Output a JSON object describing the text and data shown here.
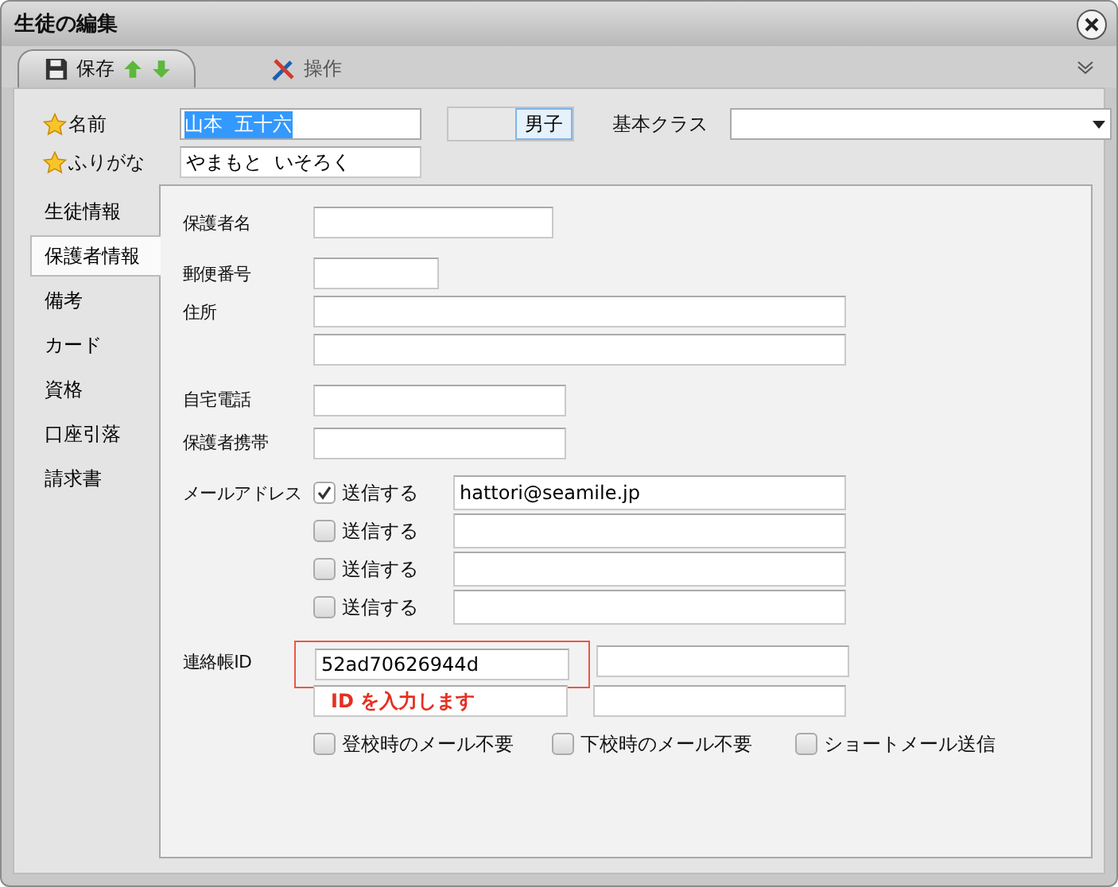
{
  "window": {
    "title": "生徒の編集"
  },
  "toolbar": {
    "tabs": [
      {
        "label": "保存",
        "selected": true
      },
      {
        "label": "操作",
        "selected": false
      }
    ]
  },
  "header": {
    "name": {
      "label": "名前",
      "value": "山本  五十六",
      "text_selected": true
    },
    "kana": {
      "label": "ふりがな",
      "value": "やまもと  いそろく"
    },
    "gender": {
      "label": "男子",
      "selected": true
    },
    "class": {
      "label": "基本クラス"
    }
  },
  "side_tabs": [
    {
      "label": "生徒情報",
      "selected": false
    },
    {
      "label": "保護者情報",
      "selected": true
    },
    {
      "label": "備考",
      "selected": false
    },
    {
      "label": "カード",
      "selected": false
    },
    {
      "label": "資格",
      "selected": false
    },
    {
      "label": "口座引落",
      "selected": false
    },
    {
      "label": "請求書",
      "selected": false
    }
  ],
  "guardian": {
    "name_label": "保護者名",
    "zip_label": "郵便番号",
    "address_label": "住所",
    "home_phone_label": "自宅電話",
    "mobile_label": "保護者携帯"
  },
  "email": {
    "label": "メールアドレス",
    "rows": [
      {
        "checked": true,
        "label": "送信する",
        "value": "hattori@seamile.jp"
      },
      {
        "checked": false,
        "label": "送信する"
      },
      {
        "checked": false,
        "label": "送信する"
      },
      {
        "checked": false,
        "label": "送信する"
      }
    ]
  },
  "contact_id": {
    "label": "連絡帳ID",
    "value": "52ad70626944d",
    "highlighted": true,
    "hint": "ID を入力します"
  },
  "options": [
    {
      "checked": false,
      "label": "登校時のメール不要"
    },
    {
      "checked": false,
      "label": "下校時のメール不要"
    },
    {
      "checked": false,
      "label": "ショートメール送信"
    }
  ]
}
